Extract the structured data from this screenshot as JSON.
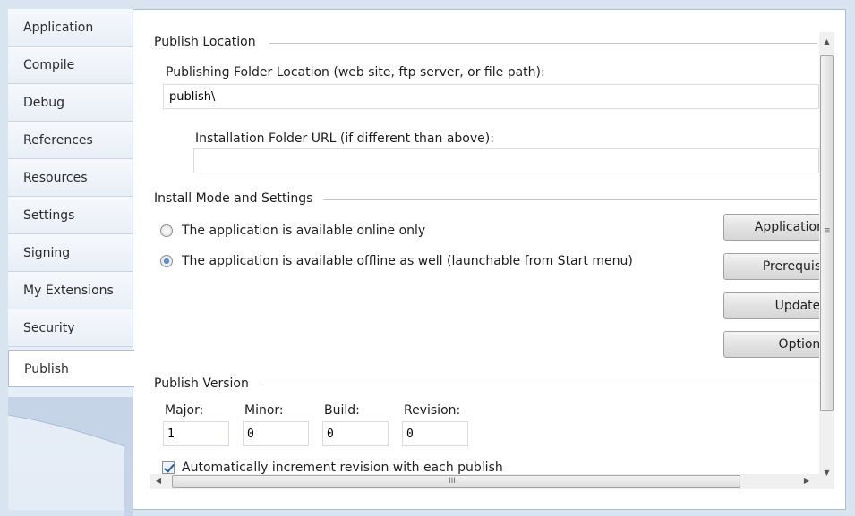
{
  "tabs": [
    {
      "label": "Application"
    },
    {
      "label": "Compile"
    },
    {
      "label": "Debug"
    },
    {
      "label": "References"
    },
    {
      "label": "Resources"
    },
    {
      "label": "Settings"
    },
    {
      "label": "Signing"
    },
    {
      "label": "My Extensions"
    },
    {
      "label": "Security"
    },
    {
      "label": "Publish"
    }
  ],
  "active_tab": "Publish",
  "publish_location": {
    "section_title": "Publish Location",
    "folder_label": "Publishing Folder Location (web site, ftp server, or file path):",
    "folder_value": "publish\\",
    "install_url_label": "Installation Folder URL (if different than above):",
    "install_url_value": ""
  },
  "install_mode": {
    "section_title": "Install Mode and Settings",
    "options": [
      {
        "label": "The application is available online only",
        "checked": false
      },
      {
        "label": "The application is available offline as well (launchable from Start menu)",
        "checked": true
      }
    ],
    "buttons": [
      {
        "label": "Application"
      },
      {
        "label": "Prerequisi"
      },
      {
        "label": "Update:"
      },
      {
        "label": "Option:"
      }
    ]
  },
  "publish_version": {
    "section_title": "Publish Version",
    "fields": [
      {
        "label": "Major:",
        "value": "1"
      },
      {
        "label": "Minor:",
        "value": "0"
      },
      {
        "label": "Build:",
        "value": "0"
      },
      {
        "label": "Revision:",
        "value": "0"
      }
    ],
    "auto_increment_label": "Automatically increment revision with each publish",
    "auto_increment_checked": true
  },
  "icons": {
    "scroll_up": "▲",
    "scroll_down": "▼",
    "scroll_left": "◀",
    "scroll_right": "▶",
    "vgrip": "≡",
    "hgrip": "III"
  },
  "colors": {
    "accent": "#1b5fae",
    "frame": "#d9e4f1"
  }
}
